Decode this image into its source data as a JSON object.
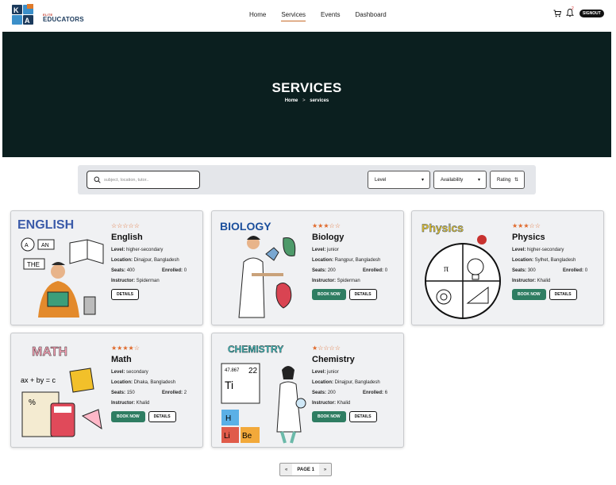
{
  "nav": {
    "logo_small": "ELITE",
    "logo_text": "EDUCATORS",
    "links": [
      "Home",
      "Services",
      "Events",
      "Dashboard"
    ],
    "active": "Services",
    "notification_count": "2",
    "signout_label": "SIGNOUT"
  },
  "hero": {
    "title": "SERVICES",
    "breadcrumb_home": "Home",
    "breadcrumb_sep": ">",
    "breadcrumb_current": "services"
  },
  "filters": {
    "search_placeholder": "subject, location, tutor..",
    "level": "Level",
    "availability": "Availability",
    "rating": "Rating"
  },
  "labels": {
    "level": "Level:",
    "location": "Location:",
    "seats": "Seats:",
    "enrolled": "Enrolled:",
    "instructor": "Instructor:",
    "book_now": "BOOK NOW",
    "details": "DETAILS"
  },
  "services": [
    {
      "title": "English",
      "stars": "☆☆☆☆☆",
      "level": "higher-secondary",
      "location": "Dinajpur, Bangladesh",
      "seats": "400",
      "enrolled": "0",
      "instructor": "Spiderman",
      "bookable": false,
      "art_label": "ENGLISH"
    },
    {
      "title": "Biology",
      "stars": "★★★☆☆",
      "level": "junior",
      "location": "Rangpur, Bangladesh",
      "seats": "200",
      "enrolled": "0",
      "instructor": "Spiderman",
      "bookable": true,
      "art_label": "BIOLOGY"
    },
    {
      "title": "Physics",
      "stars": "★★★☆☆",
      "level": "higher-secondary",
      "location": "Sylhet, Bangladesh",
      "seats": "300",
      "enrolled": "0",
      "instructor": "Khalid",
      "bookable": true,
      "art_label": "Physics"
    },
    {
      "title": "Math",
      "stars": "★★★★☆",
      "level": "secondary",
      "location": "Dhaka, Bangladesh",
      "seats": "150",
      "enrolled": "2",
      "instructor": "Khalid",
      "bookable": true,
      "art_label": "MATH"
    },
    {
      "title": "Chemistry",
      "stars": "★☆☆☆☆",
      "level": "junior",
      "location": "Dinajpur, Bangladesh",
      "seats": "200",
      "enrolled": "6",
      "instructor": "Khalid",
      "bookable": true,
      "art_label": "CHEMISTRY"
    }
  ],
  "pagination": {
    "prev": "«",
    "current": "PAGE 1",
    "next": "»"
  },
  "colors": {
    "hero": "#0b1f1f",
    "accent": "#2e7d62",
    "star": "#e06a2c"
  }
}
